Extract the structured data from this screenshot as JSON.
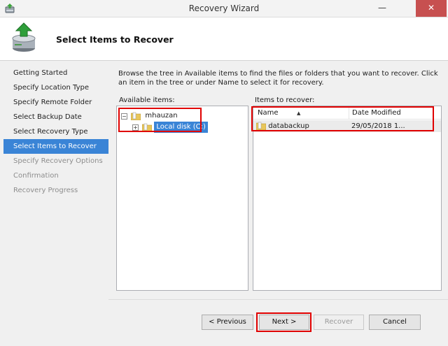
{
  "window": {
    "title": "Recovery Wizard",
    "minimize_label": "—",
    "close_label": "✕"
  },
  "header": {
    "title": "Select Items to Recover"
  },
  "nav": {
    "items": [
      {
        "label": "Getting Started",
        "state": "normal"
      },
      {
        "label": "Specify Location Type",
        "state": "normal"
      },
      {
        "label": "Specify Remote Folder",
        "state": "normal"
      },
      {
        "label": "Select Backup Date",
        "state": "normal"
      },
      {
        "label": "Select Recovery Type",
        "state": "normal"
      },
      {
        "label": "Select Items to Recover",
        "state": "active"
      },
      {
        "label": "Specify Recovery Options",
        "state": "disabled"
      },
      {
        "label": "Confirmation",
        "state": "disabled"
      },
      {
        "label": "Recovery Progress",
        "state": "disabled"
      }
    ]
  },
  "content": {
    "instruction": "Browse the tree in Available items to find the files or folders that you want to recover. Click an item in the tree or under Name to select it for recovery.",
    "available_label": "Available items:",
    "recover_label": "Items to recover:"
  },
  "tree": {
    "root": {
      "label": "mhauzan",
      "expander": "−"
    },
    "child": {
      "label": "Local disk (C:)",
      "expander": "+",
      "selected": true
    }
  },
  "list": {
    "columns": {
      "name": "Name",
      "date": "Date Modified"
    },
    "rows": [
      {
        "name": "databackup",
        "date": "29/05/2018 1..."
      }
    ]
  },
  "buttons": {
    "previous": "< Previous",
    "next": "Next >",
    "recover": "Recover",
    "cancel": "Cancel"
  },
  "colors": {
    "accent": "#3a84d6",
    "highlight": "#e00000",
    "close": "#c75050"
  }
}
